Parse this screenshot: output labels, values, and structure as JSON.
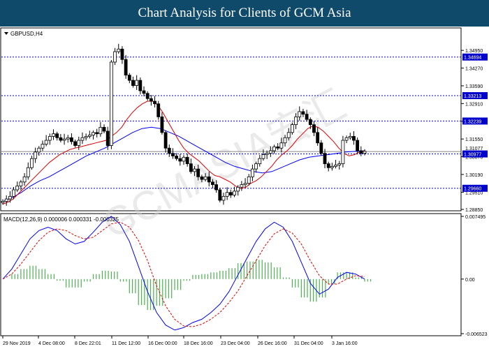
{
  "header": {
    "title": "Chart Analysis for Clients of GCM Asia"
  },
  "watermark": "GCMASIA宏汇",
  "chart_data": [
    {
      "type": "candlestick",
      "symbol_label": "GBPUSD,H4",
      "ylim": [
        1.2885,
        1.3565
      ],
      "ticks": [
        "1.34950",
        "1.34270",
        "1.33590",
        "1.32910",
        "1.32230",
        "1.31550",
        "1.30870",
        "1.30190",
        "1.29510",
        "1.28850"
      ],
      "levels": [
        {
          "value": 1.34694,
          "label": "1.34694"
        },
        {
          "value": 1.33213,
          "label": "1.33213"
        },
        {
          "value": 1.32239,
          "label": "1.32239"
        },
        {
          "value": 1.30977,
          "label": "1.30977"
        },
        {
          "value": 1.2966,
          "label": "1.29660"
        }
      ],
      "current_price": {
        "value": 1.3107,
        "label": "1.31077"
      },
      "close_series": [
        1.2916,
        1.2925,
        1.2935,
        1.296,
        1.2975,
        1.299,
        1.301,
        1.3045,
        1.308,
        1.3105,
        1.312,
        1.3135,
        1.315,
        1.3165,
        1.3175,
        1.316,
        1.315,
        1.3155,
        1.316,
        1.3145,
        1.313,
        1.315,
        1.316,
        1.3165,
        1.317,
        1.318,
        1.3175,
        1.32,
        1.3185,
        1.313,
        1.345,
        1.349,
        1.35,
        1.346,
        1.34,
        1.338,
        1.336,
        1.338,
        1.334,
        1.333,
        1.331,
        1.33,
        1.329,
        1.324,
        1.318,
        1.312,
        1.31,
        1.309,
        1.308,
        1.307,
        1.3085,
        1.306,
        1.303,
        1.304,
        1.301,
        1.3,
        1.301,
        1.299,
        1.298,
        1.296,
        1.292,
        1.2935,
        1.295,
        1.294,
        1.2955,
        1.297,
        1.298,
        1.2985,
        1.301,
        1.304,
        1.306,
        1.308,
        1.3095,
        1.31,
        1.311,
        1.3125,
        1.312,
        1.314,
        1.316,
        1.318,
        1.321,
        1.324,
        1.326,
        1.325,
        1.323,
        1.321,
        1.318,
        1.314,
        1.31,
        1.306,
        1.3045,
        1.305,
        1.3055,
        1.306,
        1.315,
        1.316,
        1.3165,
        1.315,
        1.311,
        1.31,
        1.3108
      ],
      "ma_fast": [
        1.2905,
        1.2913,
        1.2925,
        1.2945,
        1.2965,
        1.2985,
        1.3005,
        1.3025,
        1.3045,
        1.3065,
        1.308,
        1.3095,
        1.3105,
        1.3115,
        1.312,
        1.3125,
        1.313,
        1.3135,
        1.314,
        1.3145,
        1.315,
        1.3165,
        1.318,
        1.32,
        1.323,
        1.3255,
        1.3275,
        1.329,
        1.33,
        1.33,
        1.3285,
        1.3255,
        1.322,
        1.3185,
        1.315,
        1.312,
        1.31,
        1.3085,
        1.307,
        1.305,
        1.303,
        1.3015,
        1.301,
        1.3,
        1.299,
        1.2975,
        1.2965,
        1.297,
        1.2985,
        1.2995,
        1.301,
        1.303,
        1.305,
        1.3075,
        1.3095,
        1.311,
        1.313,
        1.3155,
        1.3175,
        1.3195,
        1.3205,
        1.32,
        1.3185,
        1.3165,
        1.3145,
        1.312,
        1.31,
        1.309,
        1.3095,
        1.3105,
        1.311
      ],
      "ma_slow": [
        1.2915,
        1.293,
        1.295,
        1.2975,
        1.2995,
        1.301,
        1.303,
        1.305,
        1.307,
        1.309,
        1.3105,
        1.312,
        1.314,
        1.316,
        1.318,
        1.3195,
        1.32,
        1.3195,
        1.318,
        1.3165,
        1.3145,
        1.3125,
        1.3105,
        1.3085,
        1.3065,
        1.305,
        1.304,
        1.303,
        1.3025,
        1.303,
        1.3045,
        1.306,
        1.3075,
        1.3085,
        1.309,
        1.3095,
        1.31,
        1.3105,
        1.3108,
        1.311
      ],
      "x_ticks": [
        "29 Nov 2019",
        "4 Dec 08:00",
        "8 Dec 22:01",
        "11 Dec 12:00",
        "16 Dec 00:00",
        "18 Dec 16:00",
        "23 Dec 04:00",
        "26 Dec 16:00",
        "31 Dec 04:00",
        "3 Jan 16:00"
      ],
      "colors": {
        "level": "#0000cc",
        "ma_fast": "#dd0000",
        "ma_slow": "#0000ff",
        "candle": "#000000"
      }
    },
    {
      "type": "macd",
      "label": "MACD(12,26,9) 0.000006 0.000331 -0.000325",
      "ylim": [
        -0.006523,
        0.007495
      ],
      "ticks": [
        "0.007495",
        "0.00",
        "-0.006523"
      ],
      "macd": [
        0.0,
        0.0012,
        0.003,
        0.0048,
        0.0058,
        0.0062,
        0.0058,
        0.0048,
        0.0042,
        0.0045,
        0.0056,
        0.0068,
        0.0075,
        0.0065,
        0.0045,
        0.0015,
        -0.0015,
        -0.004,
        -0.0055,
        -0.0061,
        -0.0058,
        -0.0052,
        -0.0048,
        -0.004,
        -0.003,
        -0.0015,
        0.0005,
        0.0025,
        0.0045,
        0.006,
        0.0068,
        0.0062,
        0.0045,
        0.002,
        -0.0005,
        -0.0018,
        -0.0012,
        0.0002,
        0.0008,
        0.0006,
        0.0
      ],
      "signal": [
        0.0,
        0.0006,
        0.0018,
        0.0032,
        0.0046,
        0.0056,
        0.006,
        0.0058,
        0.0052,
        0.0048,
        0.005,
        0.0058,
        0.0066,
        0.0068,
        0.0062,
        0.0046,
        0.0022,
        -0.0008,
        -0.0032,
        -0.0048,
        -0.0056,
        -0.0057,
        -0.0054,
        -0.0048,
        -0.004,
        -0.0028,
        -0.0014,
        0.0004,
        0.0022,
        0.004,
        0.0054,
        0.006,
        0.0055,
        0.0042,
        0.0022,
        0.0004,
        -0.0006,
        -0.0006,
        0.0,
        0.0004,
        0.0003
      ],
      "colors": {
        "macd": "#0000ff",
        "signal": "#dd0000",
        "histogram": "#4caf50"
      }
    }
  ]
}
